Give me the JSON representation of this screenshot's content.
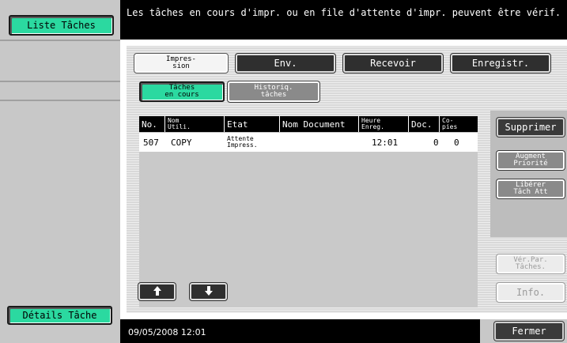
{
  "left_panel": {
    "task_list_button": "Liste Tâches",
    "task_details_button": "Détails Tâche"
  },
  "header": {
    "message": "Les tâches en cours d'impr. ou en file d'attente d'impr. peuvent être vérif."
  },
  "tabs": [
    {
      "label_line1": "Impres-",
      "label_line2": "sion",
      "active": true
    },
    {
      "label": "Env.",
      "active": false
    },
    {
      "label": "Recevoir",
      "active": false
    },
    {
      "label": "Enregistr.",
      "active": false
    }
  ],
  "subtabs": [
    {
      "label_line1": "Tâches",
      "label_line2": "en cours",
      "active": true
    },
    {
      "label_line1": "Historiq.",
      "label_line2": "tâches",
      "active": false
    }
  ],
  "table": {
    "headers": {
      "no": "No.",
      "user_line1": "Nom",
      "user_line2": "Utili.",
      "status": "Etat",
      "doc_name": "Nom Document",
      "time_line1": "Heure",
      "time_line2": "Enreg.",
      "docs": "Doc.",
      "copies_line1": "Co-",
      "copies_line2": "pies"
    },
    "rows": [
      {
        "no": "507",
        "user": "COPY",
        "status_line1": "Attente",
        "status_line2": "Impress.",
        "doc_name": "",
        "time": "12:01",
        "docs": "0",
        "copies": "0"
      }
    ]
  },
  "actions": {
    "delete": "Supprimer",
    "raise_priority_line1": "Augment",
    "raise_priority_line2": "Priorité",
    "release_line1": "Libérer",
    "release_line2": "Tâch Att",
    "check_settings_line1": "Vér.Par.",
    "check_settings_line2": "Tâches.",
    "info": "Info.",
    "close": "Fermer"
  },
  "footer": {
    "datetime": "09/05/2008   12:01"
  },
  "icons": {
    "scroll_up": "arrow-up-icon",
    "scroll_down": "arrow-down-icon"
  },
  "colors": {
    "accent_green": "#2bd9a0",
    "dark_button": "#3a3a3a",
    "panel_grey": "#d9d9d9"
  }
}
